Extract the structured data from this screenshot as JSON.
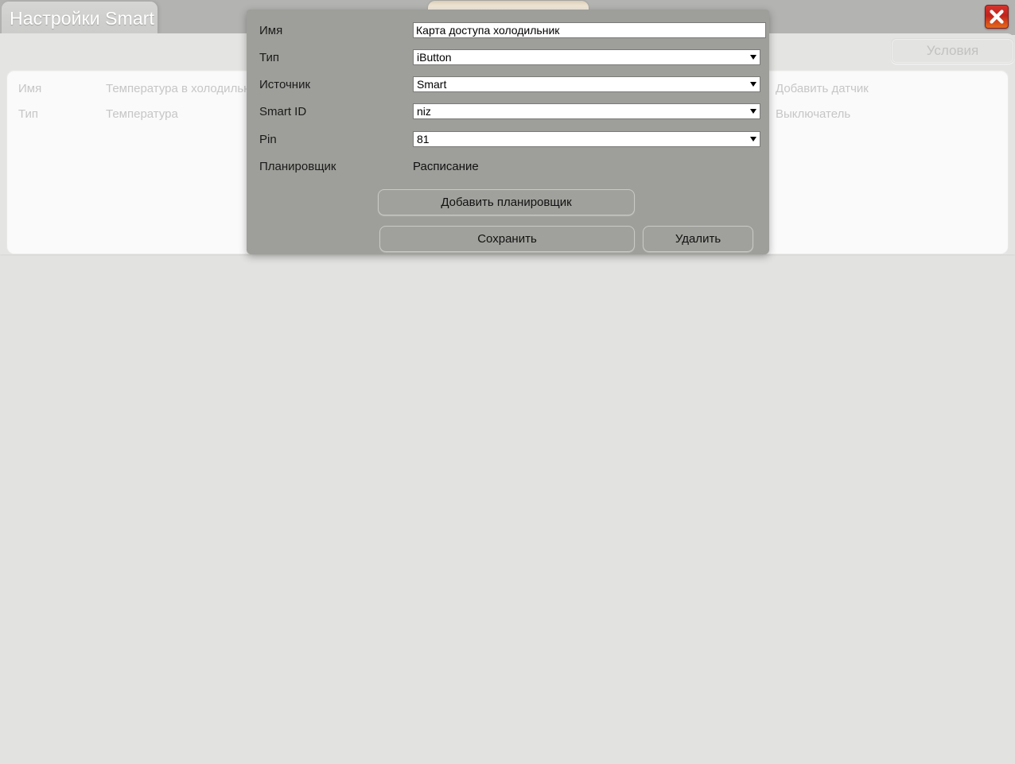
{
  "window": {
    "tab_label": "Настройки Smart",
    "close_icon": "close-icon"
  },
  "toolbar": {
    "conditions_label": "Условия"
  },
  "content_panel": {
    "rows": [
      {
        "key": "Имя",
        "value": "Температура в холодильнике"
      },
      {
        "key": "Тип",
        "value": "Температура"
      }
    ],
    "right_items": [
      {
        "label": "Добавить датчик"
      },
      {
        "label": "Выключатель"
      }
    ]
  },
  "modal": {
    "fields": [
      {
        "label": "Имя",
        "control": "text",
        "value": "Карта доступа холодильник",
        "placeholder": ""
      },
      {
        "label": "Тип",
        "control": "select",
        "value": "iButton",
        "arrow_icon": "chevron-down-icon"
      },
      {
        "label": "Источник",
        "control": "select",
        "value": "Smart",
        "arrow_icon": "chevron-down-icon"
      },
      {
        "label": "Smart ID",
        "control": "select",
        "value": "niz",
        "arrow_icon": "chevron-down-icon"
      },
      {
        "label": "Pin",
        "control": "select",
        "value": "81",
        "arrow_icon": "chevron-down-icon"
      },
      {
        "label": "Планировщик",
        "control": "static",
        "value": "Расписание"
      }
    ],
    "buttons": {
      "add_scheduler": "Добавить планировщик",
      "save": "Сохранить",
      "delete": "Удалить"
    }
  },
  "colors": {
    "page_bg": "#e2e2e0",
    "topbar": "#b3b3b1",
    "modal_bg": "#9e9e9a",
    "panel_bg": "#fafafa",
    "muted_text": "#c6c6c6",
    "close_red": "#c0231c",
    "tab_peach": "#f0e6d4"
  }
}
